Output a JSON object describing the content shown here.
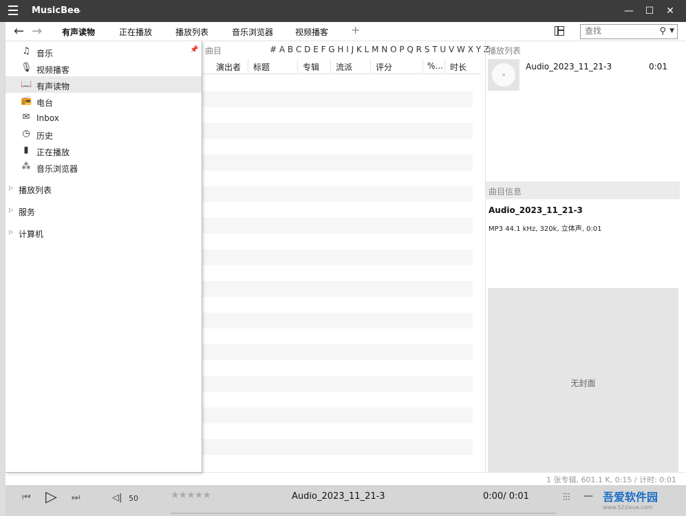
{
  "app": {
    "title": "MusicBee"
  },
  "window": {
    "minimize": "—",
    "maximize": "☐",
    "close": "✕"
  },
  "nav": {
    "back": "←",
    "forward": "→"
  },
  "tabs": [
    {
      "label": "有声读物",
      "active": true
    },
    {
      "label": "正在播放"
    },
    {
      "label": "播放列表"
    },
    {
      "label": "音乐浏览器"
    },
    {
      "label": "视频播客"
    }
  ],
  "tab_add": "+",
  "search": {
    "placeholder": "查找",
    "value": ""
  },
  "sidebar": {
    "items": [
      {
        "label": "音乐",
        "icon": "music-note-icon",
        "glyph": "♫"
      },
      {
        "label": "视频播客",
        "icon": "microphone-icon",
        "glyph": "🎙"
      },
      {
        "label": "有声读物",
        "icon": "book-icon",
        "glyph": "📖",
        "selected": true
      },
      {
        "label": "电台",
        "icon": "radio-antenna-icon",
        "glyph": "📻"
      },
      {
        "label": "Inbox",
        "icon": "envelope-icon",
        "glyph": "✉"
      },
      {
        "label": "历史",
        "icon": "clock-icon",
        "glyph": "◷"
      },
      {
        "label": "正在播放",
        "icon": "equalizer-bars-icon",
        "glyph": "▮"
      },
      {
        "label": "音乐浏览器",
        "icon": "nodes-icon",
        "glyph": "⁂"
      }
    ],
    "groups": [
      {
        "label": "播放列表"
      },
      {
        "label": "服务"
      },
      {
        "label": "计算机"
      }
    ]
  },
  "list": {
    "header_label": "曲目",
    "alpha_index": "# A B C D E  F G H  I  J  K L M N O P Q R S  T U V W X Y Z",
    "columns": [
      "演出者",
      "标题",
      "专辑",
      "流派",
      "评分",
      "%...",
      "时长"
    ]
  },
  "right_panel": {
    "playlist_title": "播放列表",
    "track": "Audio_2023_11_21-3",
    "track_time": "0:01",
    "info_title": "曲目信息",
    "info_track": "Audio_2023_11_21-3",
    "info_detail": "MP3 44.1 kHz, 320k, 立体声, 0:01",
    "no_cover": "无封面"
  },
  "status": {
    "text": "1 张专辑, 601.1 K, 0:15 /   计时: 0:01"
  },
  "player": {
    "prev": "⏮",
    "play": "▷",
    "next": "⏭",
    "volume_icon": "◁|",
    "volume": "50",
    "rating": "★★★★★",
    "now_title": "Audio_2023_11_21-3",
    "now_time": "0:00/ 0:01",
    "eq_glyph": "⫶⫶⫶",
    "dash_glyph": "—"
  },
  "watermark": {
    "title": "吾爱软件园",
    "url": "www.52zixue.com"
  }
}
